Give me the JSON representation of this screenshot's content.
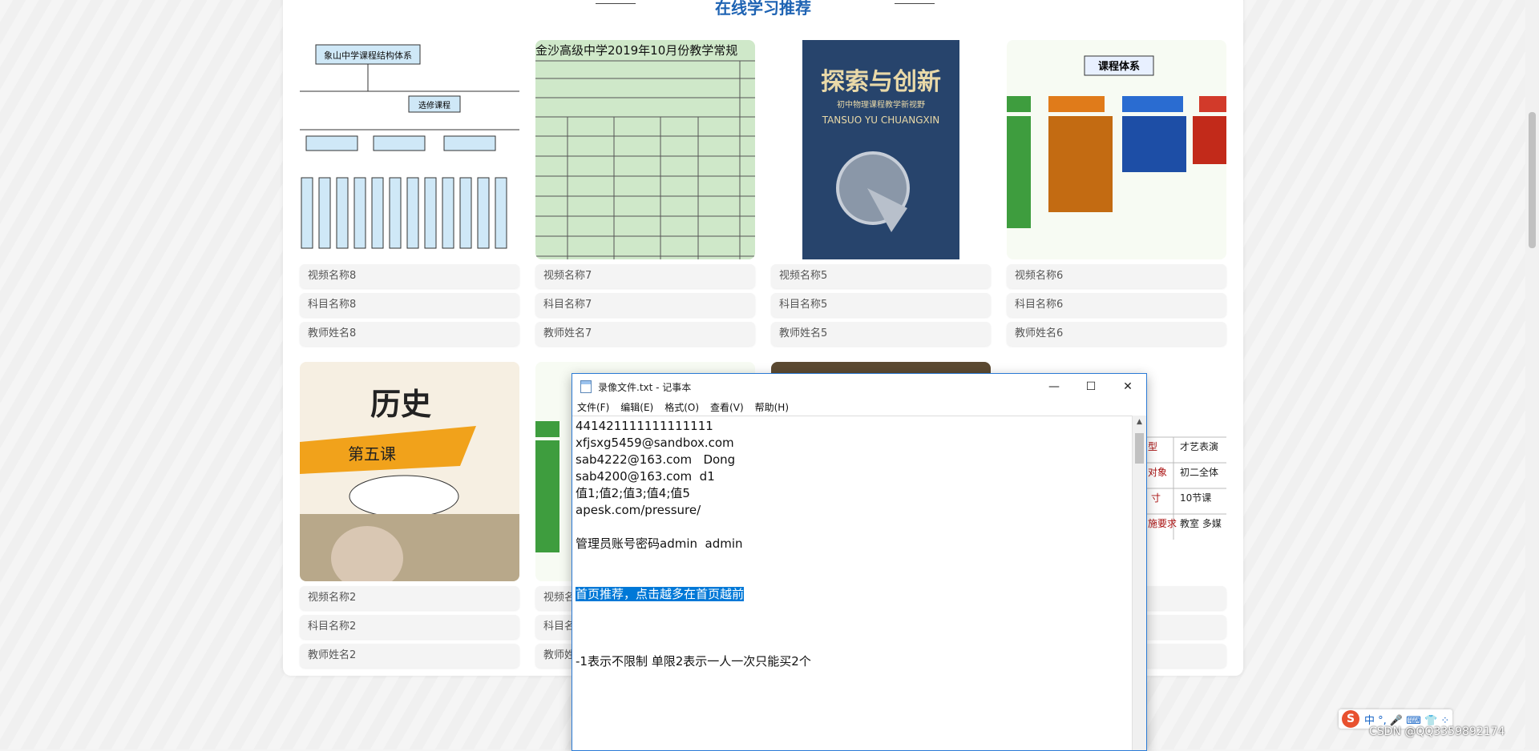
{
  "section": {
    "title": "在线学习推荐"
  },
  "cards": [
    {
      "video": "视频名称8",
      "subject": "科目名称8",
      "teacher": "教师姓名8",
      "thumb_title": "象山中学课程结构体系",
      "thumb_sub": "选修课程"
    },
    {
      "video": "视频名称7",
      "subject": "科目名称7",
      "teacher": "教师姓名7",
      "thumb_title": "金沙高级中学2019年10月份教学常规"
    },
    {
      "video": "视频名称5",
      "subject": "科目名称5",
      "teacher": "教师姓名5",
      "thumb_title": "探索与创新",
      "thumb_sub": "初中物理课程教学新视野",
      "thumb_en": "TANSUO YU CHUANGXIN"
    },
    {
      "video": "视频名称6",
      "subject": "科目名称6",
      "teacher": "教师姓名6",
      "thumb_title": "课程体系"
    },
    {
      "video": "视频名称2",
      "subject": "科目名称2",
      "teacher": "教师姓名2",
      "thumb_title": "历史",
      "thumb_sub": "第五课"
    },
    {
      "video": "视频名称",
      "subject": "科目名称",
      "teacher": "教师姓"
    },
    {},
    {
      "t1": "型",
      "t2": "才艺表演",
      "t3": "对象",
      "t4": "初二全体",
      "t5": "寸",
      "t6": "10节课",
      "t7": "施要求",
      "t8": "教室 多媒"
    }
  ],
  "notepad": {
    "title": "录像文件.txt - 记事本",
    "menu": [
      "文件(F)",
      "编辑(E)",
      "格式(O)",
      "查看(V)",
      "帮助(H)"
    ],
    "lines": [
      "441421111111111111",
      "xfjsxg5459@sandbox.com",
      "sab4222@163.com   Dong",
      "sab4200@163.com  d1",
      "值1;值2;值3;值4;值5",
      "apesk.com/pressure/",
      "管理员账号密码admin  admin",
      "首页推荐，点击越多在首页越前",
      "-1表示不限制 单限2表示一人一次只能买2个"
    ]
  },
  "ime": {
    "logo": "S",
    "status": "中 °, 🎤 ⌨ 👕 ⁘"
  },
  "watermark": "CSDN @QQ3359892174"
}
